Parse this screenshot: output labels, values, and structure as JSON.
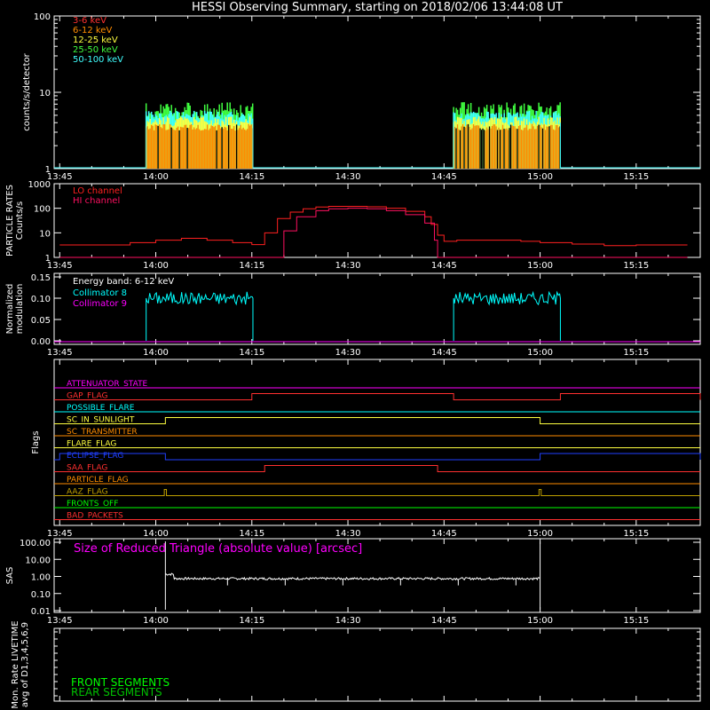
{
  "title": "HESSI Observing Summary, starting on 2018/02/06 13:44:08 UT",
  "time_ticks": [
    "13:45",
    "14:00",
    "14:15",
    "14:30",
    "14:45",
    "15:00",
    "15:15"
  ],
  "colors": {
    "band_3_6": "#ff3030",
    "band_6_12": "#ff8c00",
    "band_12_25": "#ffff40",
    "band_25_50": "#40ff40",
    "band_50_100": "#40ffff",
    "lo": "#ff2020",
    "hi": "#ff1060",
    "collimator_8": "#00ffff",
    "collimator_9": "#ff00ff",
    "sas": "#ffffff",
    "front": "#00ff00",
    "rear": "#00c000"
  },
  "chart_data": [
    {
      "type": "area",
      "name": "counts",
      "ylabel": "counts/s/detector",
      "yscale": "log",
      "ylim": [
        1,
        100
      ],
      "yticks": [
        "1",
        "10",
        "100"
      ],
      "legend": [
        "3-6 keV",
        "6-12 keV",
        "12-25 keV",
        "25-50 keV",
        "50-100 keV"
      ],
      "legend_placement": "top-left",
      "intervals": [
        {
          "start": "13:58:30",
          "end": "14:15:10"
        },
        {
          "start": "14:46:30",
          "end": "15:03:10"
        }
      ],
      "levels": {
        "3-6 keV": 3.5,
        "6-12 keV": 3.5,
        "12-25 keV": 4.2,
        "25-50 keV": 6.0,
        "50-100 keV": 5.0
      },
      "baseline": 1
    },
    {
      "type": "line",
      "name": "particle_rates",
      "ylabel": "PARTICLE RATES Counts/s",
      "yscale": "log",
      "ylim": [
        1,
        1000
      ],
      "yticks": [
        "1",
        "10",
        "100",
        "1000"
      ],
      "legend": [
        "LO channel",
        "HI channel"
      ],
      "legend_placement": "top-left",
      "lo_channel": {
        "times": [
          "13:45",
          "13:53",
          "13:56",
          "14:00",
          "14:04",
          "14:08",
          "14:12",
          "14:15",
          "14:17",
          "14:19",
          "14:21",
          "14:23",
          "14:25",
          "14:27",
          "14:30",
          "14:33",
          "14:36",
          "14:39",
          "14:42",
          "14:43",
          "14:44",
          "14:45",
          "14:47",
          "14:52",
          "14:57",
          "15:00",
          "15:05",
          "15:10",
          "15:15",
          "15:20",
          "15:23"
        ],
        "values": [
          3.2,
          3.2,
          4,
          5,
          6,
          5,
          4,
          3.3,
          10,
          38,
          70,
          95,
          112,
          120,
          120,
          115,
          100,
          75,
          45,
          22,
          8,
          4.5,
          5,
          5,
          4.5,
          4,
          3.5,
          3,
          3.2,
          3.2,
          3.2
        ]
      },
      "hi_channel": {
        "times": [
          "13:45",
          "14:18:30",
          "14:20",
          "14:22",
          "14:25",
          "14:27",
          "14:30",
          "14:33",
          "14:36",
          "14:39",
          "14:42",
          "14:43:30",
          "14:44",
          "15:23"
        ],
        "values": [
          1,
          1,
          12,
          45,
          80,
          95,
          100,
          95,
          80,
          55,
          25,
          5,
          1,
          1
        ]
      }
    },
    {
      "type": "line",
      "name": "modulation",
      "ylabel": "Normalized modulation",
      "ylim": [
        0.0,
        0.15
      ],
      "yticks": [
        "0.00",
        "0.05",
        "0.10",
        "0.15"
      ],
      "legend": [
        "Energy band: 6-12 keV",
        "Collimator 8",
        "Collimator 9"
      ],
      "legend_placement": "top-left",
      "collimator_8": {
        "intervals": [
          {
            "start": "13:58:30",
            "end": "14:15:10"
          },
          {
            "start": "14:46:30",
            "end": "15:03:10"
          }
        ],
        "mean_value": 0.1
      },
      "collimator_9": {
        "value": 0.0
      }
    },
    {
      "type": "line",
      "name": "flags",
      "ylabel": "Flags",
      "flags": [
        {
          "name": "ATTENUATOR_STATE",
          "color": "#ff00ff",
          "steps": []
        },
        {
          "name": "GAP_FLAG",
          "color": "#ff3030",
          "steps": [
            {
              "start": "14:15:00",
              "end": "14:46:30"
            },
            {
              "start": "15:03:10",
              "end": "15:25:00"
            }
          ]
        },
        {
          "name": "POSSIBLE_FLARE",
          "color": "#00ffff",
          "steps": []
        },
        {
          "name": "SC_IN_SUNLIGHT",
          "color": "#ffff40",
          "steps": [
            {
              "start": "14:01:30",
              "end": "15:00:00"
            }
          ]
        },
        {
          "name": "SC_TRANSMITTER",
          "color": "#ff8c00",
          "steps": []
        },
        {
          "name": "FLARE_FLAG",
          "color": "#ffff40",
          "steps": []
        },
        {
          "name": "ECLIPSE_FLAG",
          "color": "#2040ff",
          "steps": [
            {
              "start": "13:45:00",
              "end": "14:01:30"
            },
            {
              "start": "15:00:00",
              "end": "15:25:00"
            }
          ]
        },
        {
          "name": "SAA_FLAG",
          "color": "#ff3030",
          "steps": [
            {
              "start": "14:17:00",
              "end": "14:44:00"
            }
          ]
        },
        {
          "name": "PARTICLE_FLAG",
          "color": "#ff8c00",
          "steps": []
        },
        {
          "name": "AAZ_FLAG",
          "color": "#c0a000",
          "steps": [
            {
              "start": "14:01:20",
              "end": "14:01:40"
            },
            {
              "start": "14:59:50",
              "end": "15:00:10"
            }
          ]
        },
        {
          "name": "FRONTS_OFF",
          "color": "#00ff00",
          "steps": []
        },
        {
          "name": "BAD_PACKETS",
          "color": "#ff3030",
          "steps": []
        }
      ]
    },
    {
      "type": "line",
      "name": "sas",
      "ylabel": "SAS",
      "yscale": "log",
      "ylim": [
        0.01,
        100
      ],
      "yticks": [
        "0.01",
        "0.10",
        "1.00",
        "10.00",
        "100.00"
      ],
      "annotation": "Size of Reduced Triangle (absolute value) [arcsec]",
      "segment": {
        "start": "14:01:30",
        "end": "15:00:00",
        "typical_value": 0.75
      }
    },
    {
      "type": "line",
      "name": "livetime",
      "ylabel": "Mon. Rate LIVETIME avg of D1,3,4,5,6,9",
      "legend": [
        "FRONT SEGMENTS",
        "REAR SEGMENTS"
      ],
      "legend_placement": "bottom-left"
    }
  ]
}
